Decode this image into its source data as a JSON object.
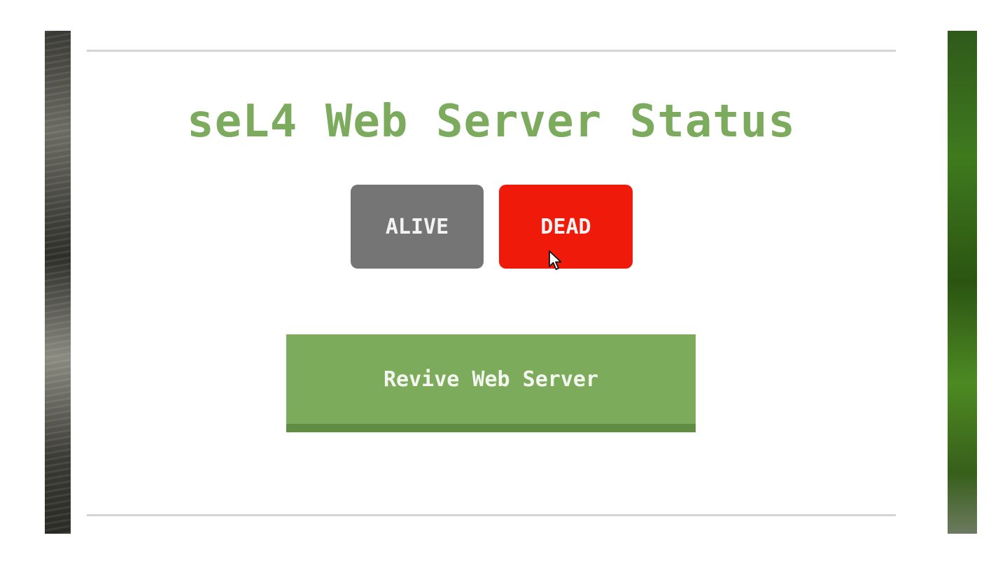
{
  "page": {
    "title": "seL4 Web Server Status"
  },
  "status_buttons": {
    "alive_label": "ALIVE",
    "dead_label": "DEAD",
    "active": "dead"
  },
  "actions": {
    "revive_label": "Revive Web Server"
  },
  "colors": {
    "accent_green": "#7cab5d",
    "alive_inactive": "#757575",
    "dead_active": "#f01a0a",
    "revive_button": "#7dab5c"
  },
  "icons": {
    "pointer": "mouse-cursor-icon"
  }
}
